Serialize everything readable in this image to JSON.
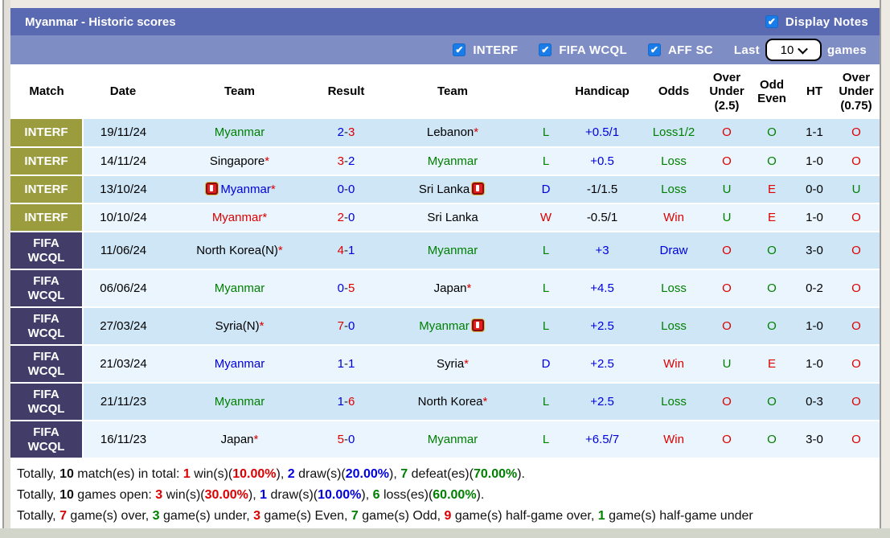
{
  "palette": {
    "red": "#dd0000",
    "blue": "#0000dd",
    "green": "#008000",
    "black": "#000000",
    "white": "#ffffff"
  },
  "title_bar": {
    "title": "Myanmar - Historic scores",
    "display_notes_label": "Display Notes",
    "display_notes_checked": true
  },
  "filter_bar": {
    "checkboxes": [
      {
        "label": "INTERF",
        "checked": true
      },
      {
        "label": "FIFA WCQL",
        "checked": true
      },
      {
        "label": "AFF SC",
        "checked": true
      }
    ],
    "last_label": "Last",
    "games_label": "games",
    "select_value": "10"
  },
  "table": {
    "columns": [
      {
        "label": "Match"
      },
      {
        "label": "Date"
      },
      {
        "label": "Team"
      },
      {
        "label": "Result"
      },
      {
        "label": "Team"
      },
      {
        "label": ""
      },
      {
        "label": "Handicap"
      },
      {
        "label": "Odds"
      },
      {
        "label": "Over\nUnder\n(2.5)"
      },
      {
        "label": "Odd\nEven"
      },
      {
        "label": "HT"
      },
      {
        "label": "Over\nUnder\n(0.75)"
      }
    ],
    "rows": [
      {
        "league": "INTERF",
        "league_class": "interf",
        "date": "19/11/24",
        "team1": {
          "name": "Myanmar",
          "color": "green"
        },
        "score": {
          "left": "2",
          "left_color": "blue",
          "right": "3",
          "right_color": "red"
        },
        "team2": {
          "name": "Lebanon",
          "color": "black",
          "asterisk": true
        },
        "wdl": {
          "text": "L",
          "color": "green"
        },
        "handicap": {
          "text": "+0.5/1",
          "color": "blue"
        },
        "odds": {
          "text": "Loss1/2",
          "color": "green"
        },
        "ou25": {
          "text": "O",
          "color": "red"
        },
        "oddeven": {
          "text": "O",
          "color": "green"
        },
        "ht": "1-1",
        "ou075": {
          "text": "O",
          "color": "red"
        }
      },
      {
        "league": "INTERF",
        "league_class": "interf",
        "date": "14/11/24",
        "team1": {
          "name": "Singapore",
          "color": "black",
          "asterisk": true
        },
        "score": {
          "left": "3",
          "left_color": "red",
          "right": "2",
          "right_color": "blue"
        },
        "team2": {
          "name": "Myanmar",
          "color": "green"
        },
        "wdl": {
          "text": "L",
          "color": "green"
        },
        "handicap": {
          "text": "+0.5",
          "color": "blue"
        },
        "odds": {
          "text": "Loss",
          "color": "green"
        },
        "ou25": {
          "text": "O",
          "color": "red"
        },
        "oddeven": {
          "text": "O",
          "color": "green"
        },
        "ht": "1-0",
        "ou075": {
          "text": "O",
          "color": "red"
        }
      },
      {
        "league": "INTERF",
        "league_class": "interf",
        "date": "13/10/24",
        "team1": {
          "name": "Myanmar",
          "color": "blue",
          "asterisk": true,
          "icon_before": true
        },
        "score": {
          "left": "0",
          "left_color": "blue",
          "right": "0",
          "right_color": "blue"
        },
        "team2": {
          "name": "Sri Lanka",
          "color": "black",
          "icon_after": true
        },
        "wdl": {
          "text": "D",
          "color": "blue"
        },
        "handicap": {
          "text": "-1/1.5",
          "color": "black"
        },
        "odds": {
          "text": "Loss",
          "color": "green"
        },
        "ou25": {
          "text": "U",
          "color": "green"
        },
        "oddeven": {
          "text": "E",
          "color": "red"
        },
        "ht": "0-0",
        "ou075": {
          "text": "U",
          "color": "green"
        }
      },
      {
        "league": "INTERF",
        "league_class": "interf",
        "date": "10/10/24",
        "team1": {
          "name": "Myanmar",
          "color": "red",
          "asterisk": true
        },
        "score": {
          "left": "2",
          "left_color": "red",
          "right": "0",
          "right_color": "blue"
        },
        "team2": {
          "name": "Sri Lanka",
          "color": "black"
        },
        "wdl": {
          "text": "W",
          "color": "red"
        },
        "handicap": {
          "text": "-0.5/1",
          "color": "black"
        },
        "odds": {
          "text": "Win",
          "color": "red"
        },
        "ou25": {
          "text": "U",
          "color": "green"
        },
        "oddeven": {
          "text": "E",
          "color": "red"
        },
        "ht": "1-0",
        "ou075": {
          "text": "O",
          "color": "red"
        }
      },
      {
        "league": "FIFA\nWCQL",
        "league_class": "fifa",
        "date": "11/06/24",
        "team1": {
          "name": "North Korea(N)",
          "color": "black",
          "asterisk": true
        },
        "score": {
          "left": "4",
          "left_color": "red",
          "right": "1",
          "right_color": "blue"
        },
        "team2": {
          "name": "Myanmar",
          "color": "green"
        },
        "wdl": {
          "text": "L",
          "color": "green"
        },
        "handicap": {
          "text": "+3",
          "color": "blue"
        },
        "odds": {
          "text": "Draw",
          "color": "blue"
        },
        "ou25": {
          "text": "O",
          "color": "red"
        },
        "oddeven": {
          "text": "O",
          "color": "green"
        },
        "ht": "3-0",
        "ou075": {
          "text": "O",
          "color": "red"
        }
      },
      {
        "league": "FIFA\nWCQL",
        "league_class": "fifa",
        "date": "06/06/24",
        "team1": {
          "name": "Myanmar",
          "color": "green"
        },
        "score": {
          "left": "0",
          "left_color": "blue",
          "right": "5",
          "right_color": "red"
        },
        "team2": {
          "name": "Japan",
          "color": "black",
          "asterisk": true
        },
        "wdl": {
          "text": "L",
          "color": "green"
        },
        "handicap": {
          "text": "+4.5",
          "color": "blue"
        },
        "odds": {
          "text": "Loss",
          "color": "green"
        },
        "ou25": {
          "text": "O",
          "color": "red"
        },
        "oddeven": {
          "text": "O",
          "color": "green"
        },
        "ht": "0-2",
        "ou075": {
          "text": "O",
          "color": "red"
        }
      },
      {
        "league": "FIFA\nWCQL",
        "league_class": "fifa",
        "date": "27/03/24",
        "team1": {
          "name": "Syria(N)",
          "color": "black",
          "asterisk": true
        },
        "score": {
          "left": "7",
          "left_color": "red",
          "right": "0",
          "right_color": "blue"
        },
        "team2": {
          "name": "Myanmar",
          "color": "green",
          "icon_after": true
        },
        "wdl": {
          "text": "L",
          "color": "green"
        },
        "handicap": {
          "text": "+2.5",
          "color": "blue"
        },
        "odds": {
          "text": "Loss",
          "color": "green"
        },
        "ou25": {
          "text": "O",
          "color": "red"
        },
        "oddeven": {
          "text": "O",
          "color": "green"
        },
        "ht": "1-0",
        "ou075": {
          "text": "O",
          "color": "red"
        }
      },
      {
        "league": "FIFA\nWCQL",
        "league_class": "fifa",
        "date": "21/03/24",
        "team1": {
          "name": "Myanmar",
          "color": "blue"
        },
        "score": {
          "left": "1",
          "left_color": "blue",
          "right": "1",
          "right_color": "blue"
        },
        "team2": {
          "name": "Syria",
          "color": "black",
          "asterisk": true
        },
        "wdl": {
          "text": "D",
          "color": "blue"
        },
        "handicap": {
          "text": "+2.5",
          "color": "blue"
        },
        "odds": {
          "text": "Win",
          "color": "red"
        },
        "ou25": {
          "text": "U",
          "color": "green"
        },
        "oddeven": {
          "text": "E",
          "color": "red"
        },
        "ht": "1-0",
        "ou075": {
          "text": "O",
          "color": "red"
        }
      },
      {
        "league": "FIFA\nWCQL",
        "league_class": "fifa",
        "date": "21/11/23",
        "team1": {
          "name": "Myanmar",
          "color": "green"
        },
        "score": {
          "left": "1",
          "left_color": "blue",
          "right": "6",
          "right_color": "red"
        },
        "team2": {
          "name": "North Korea",
          "color": "black",
          "asterisk": true
        },
        "wdl": {
          "text": "L",
          "color": "green"
        },
        "handicap": {
          "text": "+2.5",
          "color": "blue"
        },
        "odds": {
          "text": "Loss",
          "color": "green"
        },
        "ou25": {
          "text": "O",
          "color": "red"
        },
        "oddeven": {
          "text": "O",
          "color": "green"
        },
        "ht": "0-3",
        "ou075": {
          "text": "O",
          "color": "red"
        }
      },
      {
        "league": "FIFA\nWCQL",
        "league_class": "fifa",
        "date": "16/11/23",
        "team1": {
          "name": "Japan",
          "color": "black",
          "asterisk": true
        },
        "score": {
          "left": "5",
          "left_color": "red",
          "right": "0",
          "right_color": "blue"
        },
        "team2": {
          "name": "Myanmar",
          "color": "green"
        },
        "wdl": {
          "text": "L",
          "color": "green"
        },
        "handicap": {
          "text": "+6.5/7",
          "color": "blue"
        },
        "odds": {
          "text": "Win",
          "color": "red"
        },
        "ou25": {
          "text": "O",
          "color": "red"
        },
        "oddeven": {
          "text": "O",
          "color": "green"
        },
        "ht": "3-0",
        "ou075": {
          "text": "O",
          "color": "red"
        }
      }
    ]
  },
  "footer": {
    "lines": [
      [
        {
          "t": "Totally, "
        },
        {
          "t": "10",
          "b": true
        },
        {
          "t": " match(es) in total: "
        },
        {
          "t": "1",
          "c": "red",
          "b": true
        },
        {
          "t": " win(s)("
        },
        {
          "t": "10.00%",
          "c": "red",
          "b": true
        },
        {
          "t": "), "
        },
        {
          "t": "2",
          "c": "blue",
          "b": true
        },
        {
          "t": " draw(s)("
        },
        {
          "t": "20.00%",
          "c": "blue",
          "b": true
        },
        {
          "t": "), "
        },
        {
          "t": "7",
          "c": "green",
          "b": true
        },
        {
          "t": " defeat(es)("
        },
        {
          "t": "70.00%",
          "c": "green",
          "b": true
        },
        {
          "t": ")."
        }
      ],
      [
        {
          "t": "Totally, "
        },
        {
          "t": "10",
          "b": true
        },
        {
          "t": " games open: "
        },
        {
          "t": "3",
          "c": "red",
          "b": true
        },
        {
          "t": " win(s)("
        },
        {
          "t": "30.00%",
          "c": "red",
          "b": true
        },
        {
          "t": "), "
        },
        {
          "t": "1",
          "c": "blue",
          "b": true
        },
        {
          "t": " draw(s)("
        },
        {
          "t": "10.00%",
          "c": "blue",
          "b": true
        },
        {
          "t": "), "
        },
        {
          "t": "6",
          "c": "green",
          "b": true
        },
        {
          "t": " loss(es)("
        },
        {
          "t": "60.00%",
          "c": "green",
          "b": true
        },
        {
          "t": ")."
        }
      ],
      [
        {
          "t": "Totally, "
        },
        {
          "t": "7",
          "c": "red",
          "b": true
        },
        {
          "t": " game(s) over, "
        },
        {
          "t": "3",
          "c": "green",
          "b": true
        },
        {
          "t": " game(s) under, "
        },
        {
          "t": "3",
          "c": "red",
          "b": true
        },
        {
          "t": " game(s) Even, "
        },
        {
          "t": "7",
          "c": "green",
          "b": true
        },
        {
          "t": " game(s) Odd, "
        },
        {
          "t": "9",
          "c": "red",
          "b": true
        },
        {
          "t": " game(s) half-game over, "
        },
        {
          "t": "1",
          "c": "green",
          "b": true
        },
        {
          "t": " game(s) half-game under"
        }
      ]
    ]
  }
}
